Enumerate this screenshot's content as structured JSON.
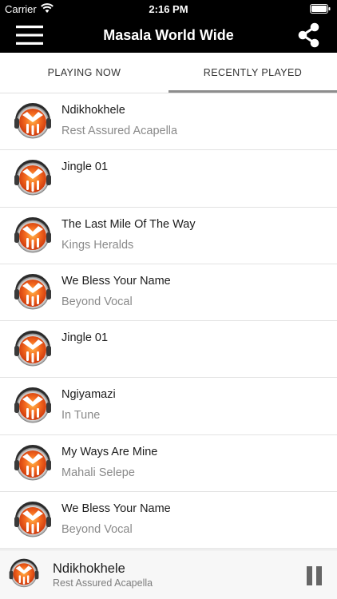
{
  "status_bar": {
    "carrier": "Carrier",
    "time": "2:16 PM",
    "wifi_icon": "wifi-icon",
    "battery_icon": "battery-icon"
  },
  "nav": {
    "title": "Masala World Wide",
    "menu_icon": "hamburger-menu-icon",
    "share_icon": "share-icon"
  },
  "tabs": [
    {
      "label": "PLAYING NOW",
      "active": false
    },
    {
      "label": "RECENTLY PLAYED",
      "active": true
    }
  ],
  "recently_played": [
    {
      "song": "Ndikhokhele",
      "artist": "Rest Assured Acapella"
    },
    {
      "song": "Jingle 01",
      "artist": ""
    },
    {
      "song": "The Last Mile Of The Way",
      "artist": "Kings Heralds"
    },
    {
      "song": "We Bless Your Name",
      "artist": "Beyond Vocal"
    },
    {
      "song": "Jingle 01",
      "artist": ""
    },
    {
      "song": "Ngiyamazi",
      "artist": "In Tune"
    },
    {
      "song": "My Ways Are Mine",
      "artist": "Mahali Selepe"
    },
    {
      "song": "We Bless Your Name",
      "artist": "Beyond Vocal"
    }
  ],
  "player": {
    "song": "Ndikhokhele",
    "artist": "Rest Assured Acapella",
    "control_icon": "pause-icon"
  },
  "colors": {
    "bar_background": "#000000",
    "logo_orange": "#f25a14",
    "tab_underline": "#8d8d8d"
  }
}
